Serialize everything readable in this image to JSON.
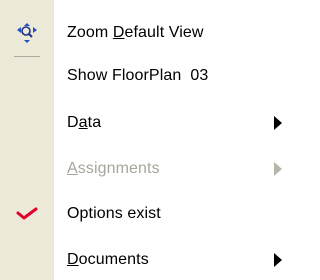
{
  "menu": {
    "items": [
      {
        "label_pre": "Zoom ",
        "label_mn": "D",
        "label_post": "efault View",
        "icon": "zoom-icon",
        "disabled": false,
        "has_submenu": false
      },
      {
        "label": "Show FloorPlan  03",
        "icon": "",
        "disabled": false,
        "has_submenu": false
      },
      {
        "label_pre": "D",
        "label_mn": "a",
        "label_post": "ta",
        "icon": "",
        "disabled": false,
        "has_submenu": true
      },
      {
        "label_pre": "",
        "label_mn": "A",
        "label_post": "ssignments",
        "icon": "",
        "disabled": true,
        "has_submenu": true
      },
      {
        "label": "Options exist",
        "icon": "check-icon",
        "disabled": false,
        "has_submenu": false
      },
      {
        "label_pre": "",
        "label_mn": "D",
        "label_post": "ocuments",
        "icon": "",
        "disabled": false,
        "has_submenu": true
      }
    ]
  },
  "colors": {
    "gutter": "#ece9d8",
    "disabled_text": "#a6a69c",
    "check": "#e0002a",
    "zoom_icon": "#2450c8"
  }
}
